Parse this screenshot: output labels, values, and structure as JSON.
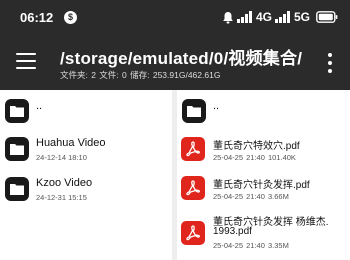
{
  "status_bar": {
    "time": "06:12",
    "badge": "$",
    "network_1": "4G",
    "network_2": "5G"
  },
  "toolbar": {
    "path": "/storage/emulated/0/视频集合/",
    "info": "文件夹: 2  文件: 0  储存: 253.91G/462.61G"
  },
  "left_pane": {
    "parent_label": "..",
    "items": [
      {
        "name": "Huahua Video",
        "meta": "24-12-14 18:10"
      },
      {
        "name": "Kzoo Video",
        "meta": "24-12-31 15:15"
      }
    ]
  },
  "right_pane": {
    "parent_label": "..",
    "items": [
      {
        "name": "董氏奇穴特效穴.pdf",
        "date": "25-04-25 21:40",
        "size": "101.40K"
      },
      {
        "name": "董氏奇穴针灸发挥.pdf",
        "date": "25-04-25 21:40",
        "size": "3.66M"
      },
      {
        "name": "董氏奇穴针灸发挥 杨维杰.",
        "name_line2": "1993.pdf",
        "date": "25-04-25 21:40",
        "size": "3.35M"
      }
    ]
  }
}
